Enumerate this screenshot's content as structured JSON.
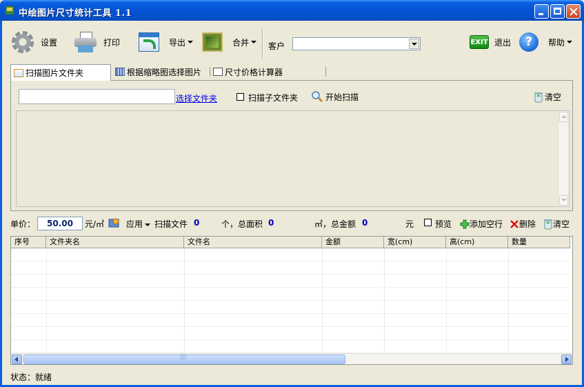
{
  "window": {
    "title": "中绘图片尺寸统计工具 1.1"
  },
  "toolbar": {
    "settings_label": "设置",
    "print_label": "打印",
    "export_label": "导出",
    "merge_label": "合并",
    "client_label": "客户",
    "client_value": "",
    "exit_icon_text": "EXIT",
    "exit_label": "退出",
    "help_icon_text": "?",
    "help_label": "帮助"
  },
  "tabs": [
    {
      "label": "扫描图片文件夹",
      "active": true
    },
    {
      "label": "根据缩略图选择图片",
      "active": false
    },
    {
      "label": "尺寸价格计算器",
      "active": false
    }
  ],
  "scan": {
    "folder_value": "",
    "select_folder_link": "选择文件夹",
    "subfolder_label": "扫描子文件夹",
    "subfolder_checked": false,
    "start_scan_label": "开始扫描",
    "clear_label": "清空"
  },
  "pricebar": {
    "unit_price_label": "单价：",
    "unit_price_value": "50.00",
    "unit_label": "元/㎡",
    "apply_label": "应用",
    "scan_files_label": "扫描文件",
    "scan_files_count": "0",
    "count_unit": "个，总面积",
    "total_area": "0",
    "area_unit": "㎡，总金额",
    "total_amount": "0",
    "currency": "元",
    "preview_label": "预览",
    "preview_checked": false,
    "add_row_label": "添加空行",
    "delete_label": "删除",
    "clear_label": "清空"
  },
  "grid": {
    "columns": [
      "序号",
      "文件夹名",
      "文件名",
      "金额",
      "宽(cm)",
      "高(cm)",
      "数量"
    ],
    "rows": []
  },
  "status": {
    "text": "状态：就绪"
  },
  "colors": {
    "title_bar": "#0553d6",
    "window_bg": "#ece9d8",
    "link": "#0000ee",
    "number": "#0000c0"
  }
}
